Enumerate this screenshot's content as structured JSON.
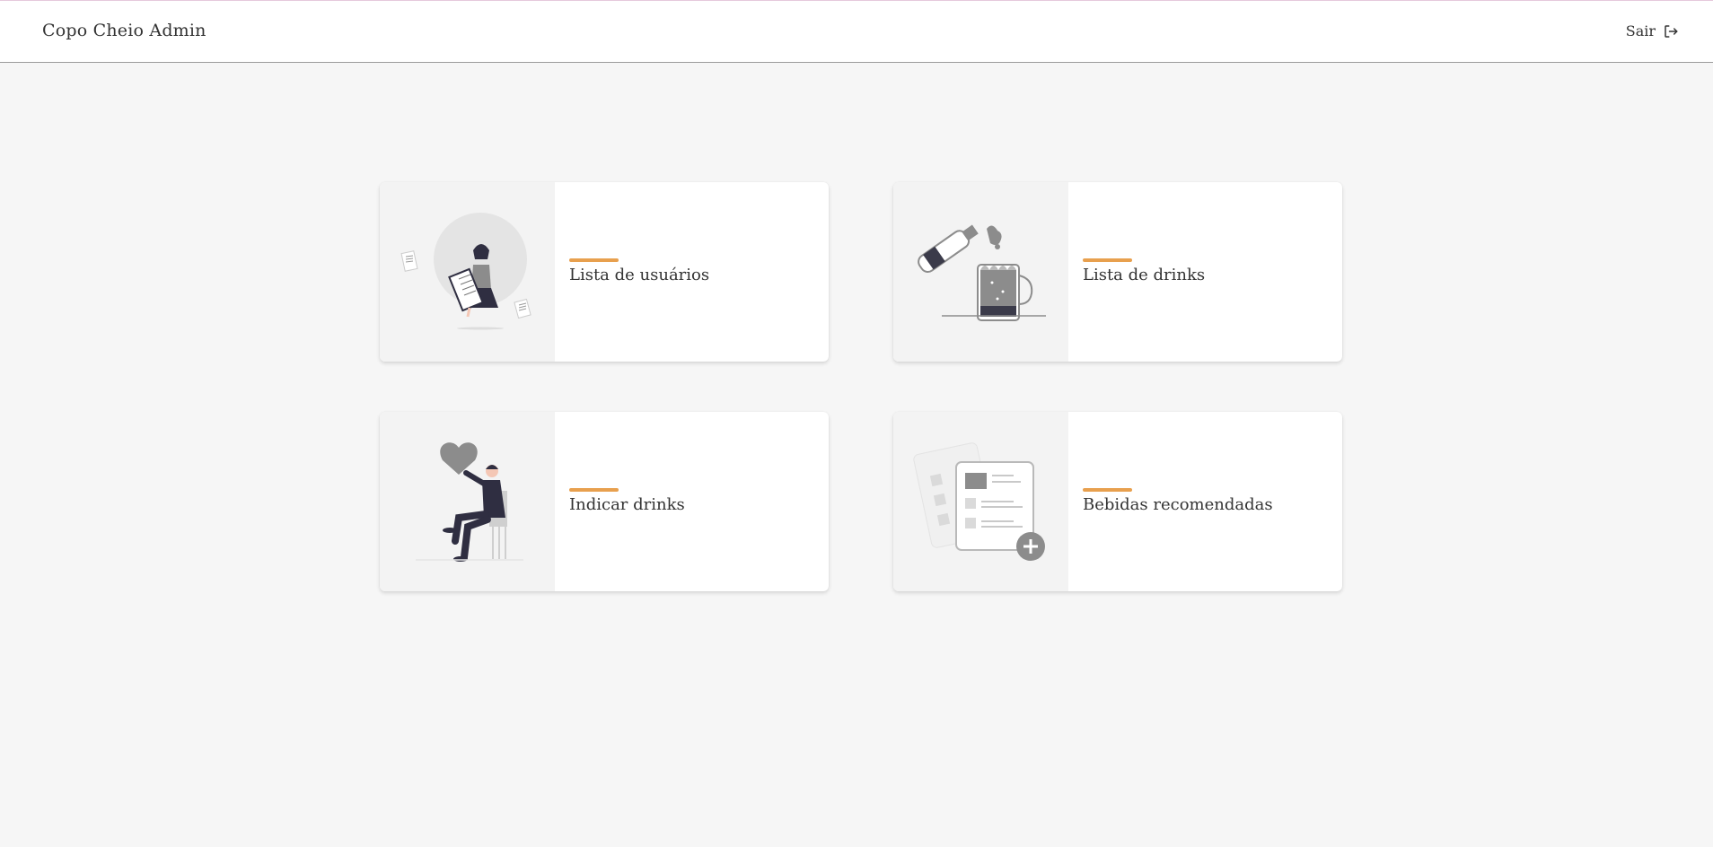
{
  "header": {
    "brand": "Copo Cheio Admin",
    "logout_label": "Sair",
    "logout_icon": "logout-icon"
  },
  "colors": {
    "accent": "#e8a04e",
    "background": "#f6f6f6",
    "card": "#ffffff",
    "illustration_gray": "#8c8c8c",
    "illustration_dark": "#2f2e41"
  },
  "cards": [
    {
      "title": "Lista de usuários",
      "icon": "woman-with-document-illustration"
    },
    {
      "title": "Lista de drinks",
      "icon": "beer-pouring-illustration"
    },
    {
      "title": "Indicar drinks",
      "icon": "man-with-heart-illustration"
    },
    {
      "title": "Bebidas recomendadas",
      "icon": "add-document-illustration"
    }
  ]
}
